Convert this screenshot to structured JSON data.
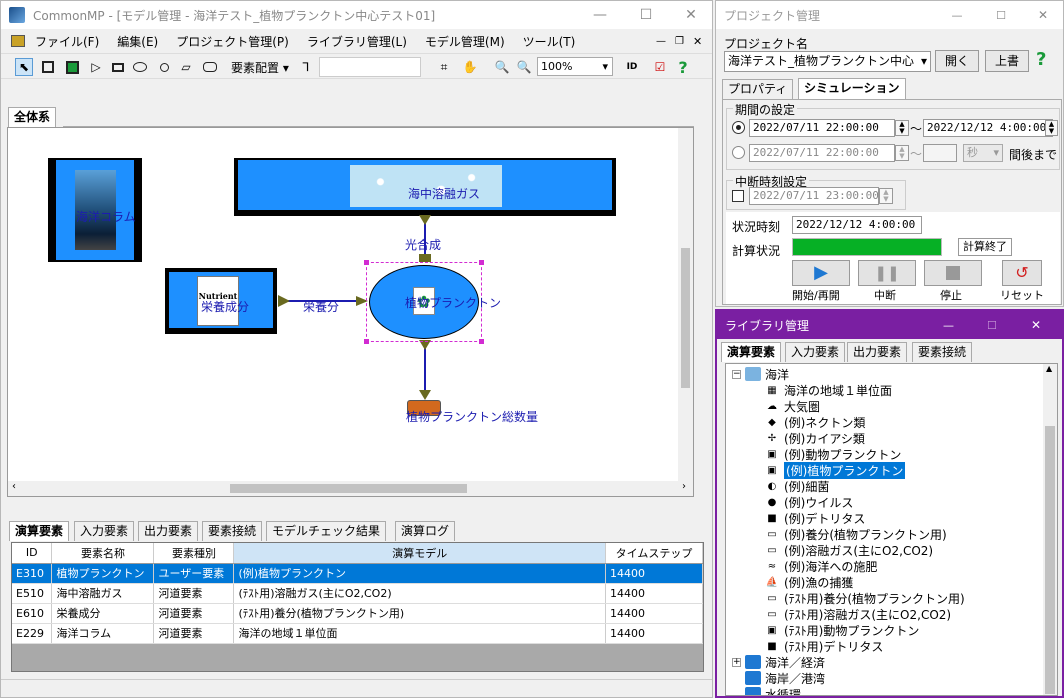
{
  "main_window": {
    "title": "CommonMP - [モデル管理 - 海洋テスト_植物プランクトン中心テスト01]",
    "menu": [
      "ファイル(F)",
      "編集(E)",
      "プロジェクト管理(P)",
      "ライブラリ管理(L)",
      "モデル管理(M)",
      "ツール(T)"
    ],
    "toolbar": {
      "layout_label": "要素配置",
      "zoom_value": "100%"
    },
    "canvas_tab": "全体系",
    "nodes": {
      "column": "海洋コラム",
      "gas": "海中溶融ガス",
      "nutrient": "栄養成分",
      "nutrient_img_text": "Nutrient",
      "plankton": "植物プランクトン",
      "total": "植物プランクトン総数量"
    },
    "links": {
      "photo": "光合成",
      "feed": "栄養分"
    },
    "bottom_tabs": [
      "演算要素",
      "入力要素",
      "出力要素",
      "要素接続",
      "モデルチェック結果",
      "演算ログ"
    ],
    "table": {
      "headers": [
        "ID",
        "要素名称",
        "要素種別",
        "演算モデル",
        "タイムステップ"
      ],
      "rows": [
        [
          "E310",
          "植物プランクトン",
          "ユーザー要素",
          "(例)植物プランクトン",
          "14400"
        ],
        [
          "E510",
          "海中溶融ガス",
          "河道要素",
          "(ﾃｽﾄ用)溶融ガス(主にO2,CO2)",
          "14400"
        ],
        [
          "E610",
          "栄養成分",
          "河道要素",
          "(ﾃｽﾄ用)養分(植物プランクトン用)",
          "14400"
        ],
        [
          "E229",
          "海洋コラム",
          "河道要素",
          "海洋の地域１単位面",
          "14400"
        ]
      ]
    }
  },
  "project_window": {
    "title": "プロジェクト管理",
    "project_name_label": "プロジェクト名",
    "project_name": "海洋テスト_植物プランクトン中心",
    "open_button": "開く",
    "overwrite_button": "上書",
    "tabs": [
      "プロパティ",
      "シミュレーション"
    ],
    "period_group": "期間の設定",
    "start": "2022/07/11 22:00:00",
    "end": "2022/12/12  4:00:00",
    "start2": "2022/07/11 22:00:00",
    "tilde": "～",
    "unit": "秒",
    "until_label": "間後まで",
    "break_group": "中断時刻設定",
    "break_time": "2022/07/11 23:00:00",
    "status_time_label": "状況時刻",
    "status_time": "2022/12/12 4:00:00",
    "calc_status_label": "計算状況",
    "calc_progress": 1.0,
    "calc_done": "計算終了",
    "buttons": [
      "開始/再開",
      "中断",
      "停止",
      "リセット"
    ]
  },
  "library_window": {
    "title": "ライブラリ管理",
    "tabs": [
      "演算要素",
      "入力要素",
      "出力要素",
      "要素接続"
    ],
    "root": "海洋",
    "items": [
      "海洋の地域１単位面",
      "大気圏",
      "(例)ネクトン類",
      "(例)カイアシ類",
      "(例)動物プランクトン",
      "(例)植物プランクトン",
      "(例)細菌",
      "(例)ウイルス",
      "(例)デトリタス",
      "(例)養分(植物プランクトン用)",
      "(例)溶融ガス(主にO2,CO2)",
      "(例)海洋への施肥",
      "(例)漁の捕獲",
      "(ﾃｽﾄ用)養分(植物プランクトン用)",
      "(ﾃｽﾄ用)溶融ガス(主にO2,CO2)",
      "(ﾃｽﾄ用)動物プランクトン",
      "(ﾃｽﾄ用)デトリタス"
    ],
    "other_roots": [
      "海洋／経済",
      "海岸／港湾",
      "水循環"
    ]
  },
  "colors": {
    "accent": "#0078d7",
    "node_blue": "#1e90ff",
    "progress": "#06b025",
    "library_border": "#7a1fa2"
  }
}
